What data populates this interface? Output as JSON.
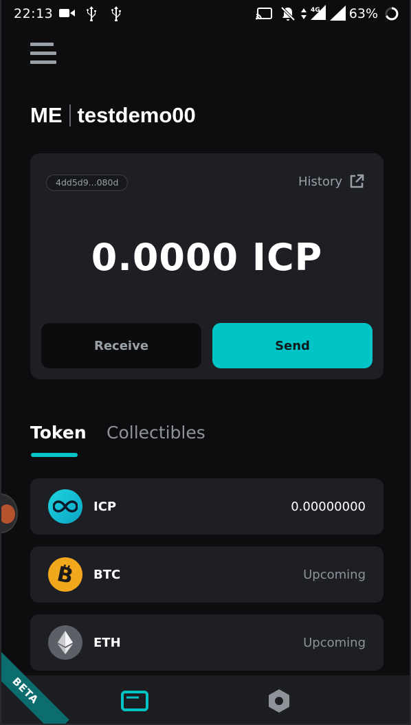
{
  "status_bar": {
    "time": "22:13",
    "battery": "63%",
    "network": "4G"
  },
  "header": {
    "brand": "ME",
    "username": "testdemo00"
  },
  "wallet": {
    "address": "4dd5d9...080d",
    "history_label": "History",
    "balance": "0.0000 ICP",
    "receive_label": "Receive",
    "send_label": "Send"
  },
  "tabs": [
    {
      "label": "Token",
      "active": true
    },
    {
      "label": "Collectibles",
      "active": false
    }
  ],
  "tokens": [
    {
      "symbol": "ICP",
      "value": "0.00000000",
      "icon": "icp-infinity-icon"
    },
    {
      "symbol": "BTC",
      "value": "Upcoming",
      "icon": "bitcoin-icon"
    },
    {
      "symbol": "ETH",
      "value": "Upcoming",
      "icon": "ethereum-icon"
    }
  ],
  "badge": "BETA",
  "colors": {
    "accent": "#00c4c6",
    "card": "#1e1f24",
    "background": "#0d0d10"
  }
}
